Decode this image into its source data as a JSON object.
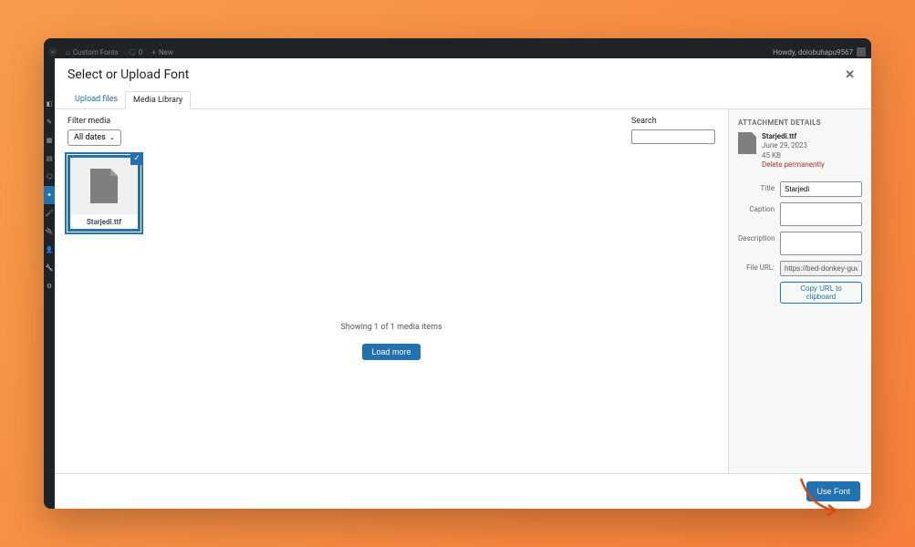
{
  "adminbar": {
    "site": "Custom Fonts",
    "new": "New",
    "howdy": "Howdy, dolobuhapu9567"
  },
  "modal": {
    "title": "Select or Upload Font",
    "tab_upload": "Upload files",
    "tab_library": "Media Library",
    "filter_label": "Filter media",
    "filter_value": "All dates",
    "search_label": "Search",
    "search_value": "",
    "item_name": "Starjedi.ttf",
    "status": "Showing 1 of 1 media items",
    "loadmore": "Load more",
    "use_font": "Use Font"
  },
  "details": {
    "heading": "ATTACHMENT DETAILS",
    "filename": "Starjedi.ttf",
    "date": "June 29, 2023",
    "size": "45 KB",
    "delete": "Delete permanently",
    "title_label": "Title",
    "title_value": "Starjedi",
    "caption_label": "Caption",
    "caption_value": "",
    "desc_label": "Description",
    "desc_value": "",
    "url_label": "File URL:",
    "url_value": "https://bed-donkey-guwo",
    "copy": "Copy URL to clipboard"
  }
}
